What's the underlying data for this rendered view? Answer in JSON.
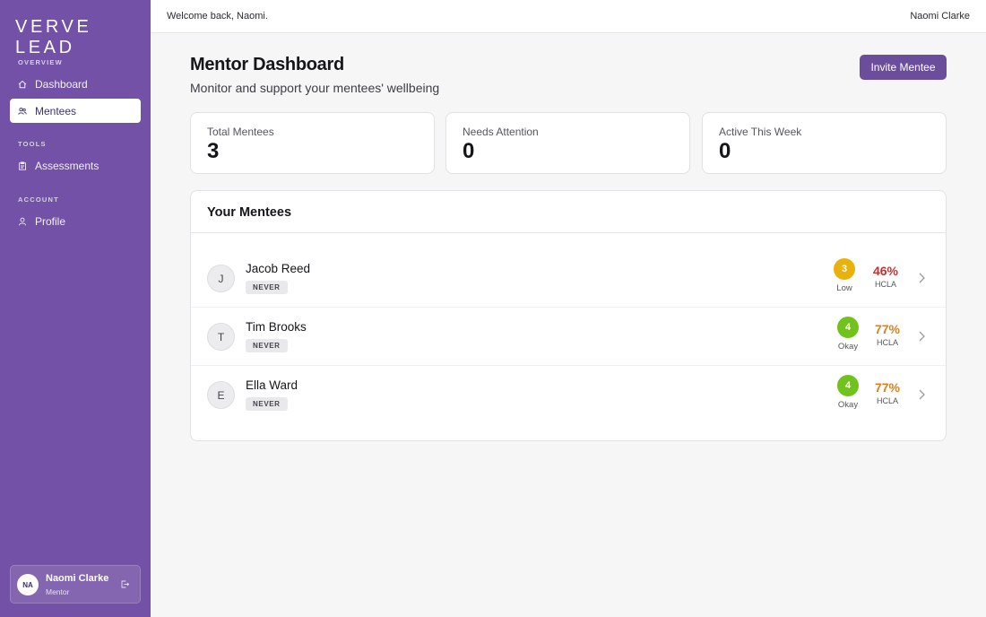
{
  "sidebar": {
    "logo": "VERVE LEAD",
    "sections": {
      "overview": "OVERVIEW",
      "tools": "TOOLS",
      "account": "ACCOUNT"
    },
    "items": {
      "dashboard": "Dashboard",
      "mentees": "Mentees",
      "assessments": "Assessments",
      "profile": "Profile"
    },
    "user": {
      "initials": "NA",
      "name": "Naomi Clarke",
      "role": "Mentor"
    }
  },
  "topbar": {
    "welcome": "Welcome back, Naomi.",
    "user_name": "Naomi Clarke"
  },
  "header": {
    "title": "Mentor Dashboard",
    "subtitle": "Monitor and support your mentees' wellbeing",
    "invite_label": "Invite Mentee"
  },
  "stats": [
    {
      "label": "Total Mentees",
      "value": "3"
    },
    {
      "label": "Needs Attention",
      "value": "0"
    },
    {
      "label": "Active This Week",
      "value": "0"
    }
  ],
  "mentees_panel": {
    "title": "Your Mentees",
    "rows": [
      {
        "initial": "J",
        "name": "Jacob Reed",
        "badge": "NEVER",
        "score": "3",
        "score_label": "Low",
        "pct": "46%",
        "pct_label": "HCLA"
      },
      {
        "initial": "T",
        "name": "Tim Brooks",
        "badge": "NEVER",
        "score": "4",
        "score_label": "Okay",
        "pct": "77%",
        "pct_label": "HCLA"
      },
      {
        "initial": "E",
        "name": "Ella Ward",
        "badge": "NEVER",
        "score": "4",
        "score_label": "Okay",
        "pct": "77%",
        "pct_label": "HCLA"
      }
    ]
  },
  "colors": {
    "sidebar": "#7351a6",
    "accent": "#6c4d9c",
    "score_low": "#e8b10c",
    "score_okay": "#72c21e",
    "pct_low": "#c62f2f",
    "pct_okay": "#d9811a"
  }
}
